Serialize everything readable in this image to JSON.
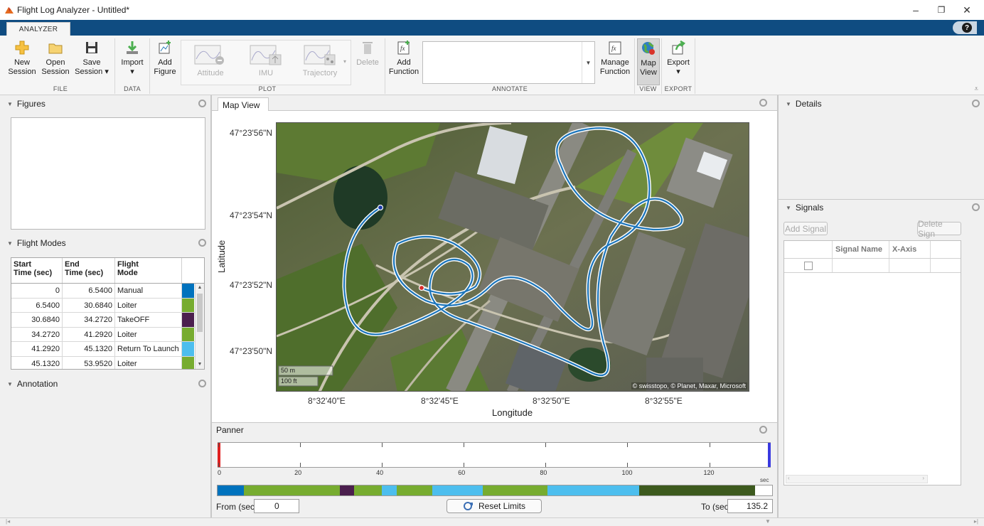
{
  "window": {
    "title": "Flight Log Analyzer - Untitled*",
    "minimize": "–",
    "restore": "❐",
    "close": "✕"
  },
  "tabs": {
    "active": "ANALYZER",
    "help": "?"
  },
  "toolstrip": {
    "file": {
      "new_session_1": "New",
      "new_session_2": "Session",
      "open_session_1": "Open",
      "open_session_2": "Session",
      "save_session_1": "Save",
      "save_session_2": "Session ▾",
      "label": "FILE"
    },
    "data": {
      "import_1": "Import",
      "import_2": "▾",
      "label": "DATA"
    },
    "plot": {
      "add_figure_1": "Add",
      "add_figure_2": "Figure",
      "attitude": "Attitude",
      "imu": "IMU",
      "trajectory": "Trajectory",
      "delete": "Delete",
      "label": "PLOT"
    },
    "annotate": {
      "add_function_1": "Add",
      "add_function_2": "Function",
      "manage_function_1": "Manage",
      "manage_function_2": "Function",
      "label": "ANNOTATE"
    },
    "view": {
      "map_view_1": "Map",
      "map_view_2": "View",
      "label": "VIEW"
    },
    "export": {
      "export_1": "Export",
      "export_2": "▾",
      "label": "EXPORT"
    }
  },
  "panels": {
    "figures": "Figures",
    "flight_modes": "Flight Modes",
    "annotation": "Annotation",
    "details": "Details",
    "signals": "Signals",
    "panner": "Panner",
    "map_view_tab": "Map View"
  },
  "flight_modes": {
    "headers": [
      "Start Time (sec)",
      "End Time (sec)",
      "Flight Mode"
    ],
    "header_lines": [
      [
        "Start",
        "Time (sec)"
      ],
      [
        "End",
        "Time (sec)"
      ],
      [
        "Flight",
        "Mode"
      ]
    ],
    "rows": [
      {
        "start": "0",
        "end": "6.5400",
        "mode": "Manual",
        "color": "#0072bd"
      },
      {
        "start": "6.5400",
        "end": "30.6840",
        "mode": "Loiter",
        "color": "#77ac30"
      },
      {
        "start": "30.6840",
        "end": "34.2720",
        "mode": "TakeOFF",
        "color": "#4b1f4e"
      },
      {
        "start": "34.2720",
        "end": "41.2920",
        "mode": "Loiter",
        "color": "#77ac30"
      },
      {
        "start": "41.2920",
        "end": "45.1320",
        "mode": "Return To Launch",
        "color": "#4dbeee"
      },
      {
        "start": "45.1320",
        "end": "53.9520",
        "mode": "Loiter",
        "color": "#77ac30"
      }
    ]
  },
  "map": {
    "lat_ticks": [
      "47°23'56\"N",
      "47°23'54\"N",
      "47°23'52\"N",
      "47°23'50\"N"
    ],
    "lon_ticks": [
      "8°32'40\"E",
      "8°32'45\"E",
      "8°32'50\"E",
      "8°32'55\"E"
    ],
    "xlabel": "Longitude",
    "ylabel": "Latitude",
    "scale_m": "50 m",
    "scale_ft": "100 ft",
    "attribution": "© swisstopo, © Planet, Maxar, Microsoft"
  },
  "panner": {
    "ticks": [
      "0",
      "20",
      "40",
      "60",
      "80",
      "100",
      "120"
    ],
    "unit": "sec",
    "from_label": "From (sec)",
    "from_value": "0",
    "to_label": "To (sec)",
    "to_value": "135.2",
    "reset": "Reset Limits",
    "segments": [
      {
        "start": 0,
        "end": 6.54,
        "color": "#0072bd"
      },
      {
        "start": 6.54,
        "end": 30.684,
        "color": "#77ac30"
      },
      {
        "start": 30.684,
        "end": 34.272,
        "color": "#4b1f4e"
      },
      {
        "start": 34.272,
        "end": 41.292,
        "color": "#77ac30"
      },
      {
        "start": 41.292,
        "end": 45.132,
        "color": "#4dbeee"
      },
      {
        "start": 45.132,
        "end": 53.952,
        "color": "#77ac30"
      },
      {
        "start": 53.952,
        "end": 66.8,
        "color": "#4dbeee"
      },
      {
        "start": 66.8,
        "end": 82.9,
        "color": "#77ac30"
      },
      {
        "start": 82.9,
        "end": 106.1,
        "color": "#4dbeee"
      },
      {
        "start": 106.1,
        "end": 135.2,
        "color": "#3d5a1e"
      }
    ],
    "max": 135.2
  },
  "signals": {
    "add": "Add Signal",
    "delete": "Delete Sign",
    "headers": [
      "",
      "Signal Name",
      "X-Axis"
    ]
  }
}
